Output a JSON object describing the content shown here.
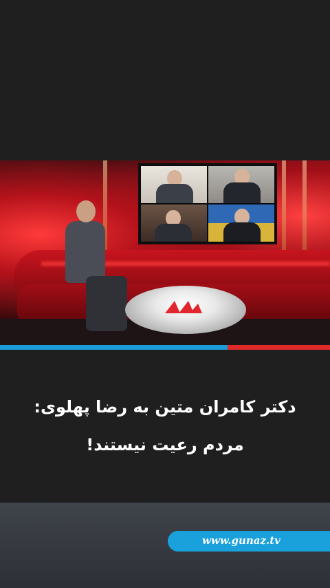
{
  "video": {
    "progress_fraction": 0.69
  },
  "caption": {
    "line1": "دکتر کامران متین به رضا پهلوی:",
    "line2": "مردم رعیت نیستند!"
  },
  "footer": {
    "url": "www.gunaz.tv"
  },
  "colors": {
    "background": "#1f1f1f",
    "progress_played": "#1b9bd8",
    "progress_remaining": "#e02a2a",
    "url_pill": "#1aa1dc"
  }
}
